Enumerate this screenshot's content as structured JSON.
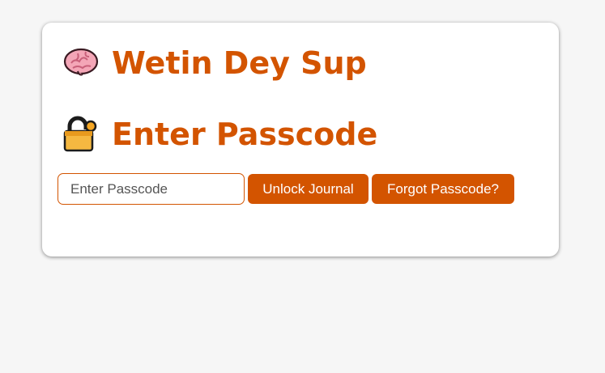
{
  "app": {
    "title": "Wetin Dey Sup",
    "title_icon": "brain-icon"
  },
  "lock_section": {
    "heading": "Enter Passcode",
    "heading_icon": "unlocked-padlock-icon",
    "input_placeholder": "Enter Passcode",
    "input_value": "",
    "unlock_label": "Unlock Journal",
    "forgot_label": "Forgot Passcode?"
  },
  "colors": {
    "accent": "#d35400",
    "page_background": "#f6f6f6",
    "card_background": "#ffffff"
  }
}
